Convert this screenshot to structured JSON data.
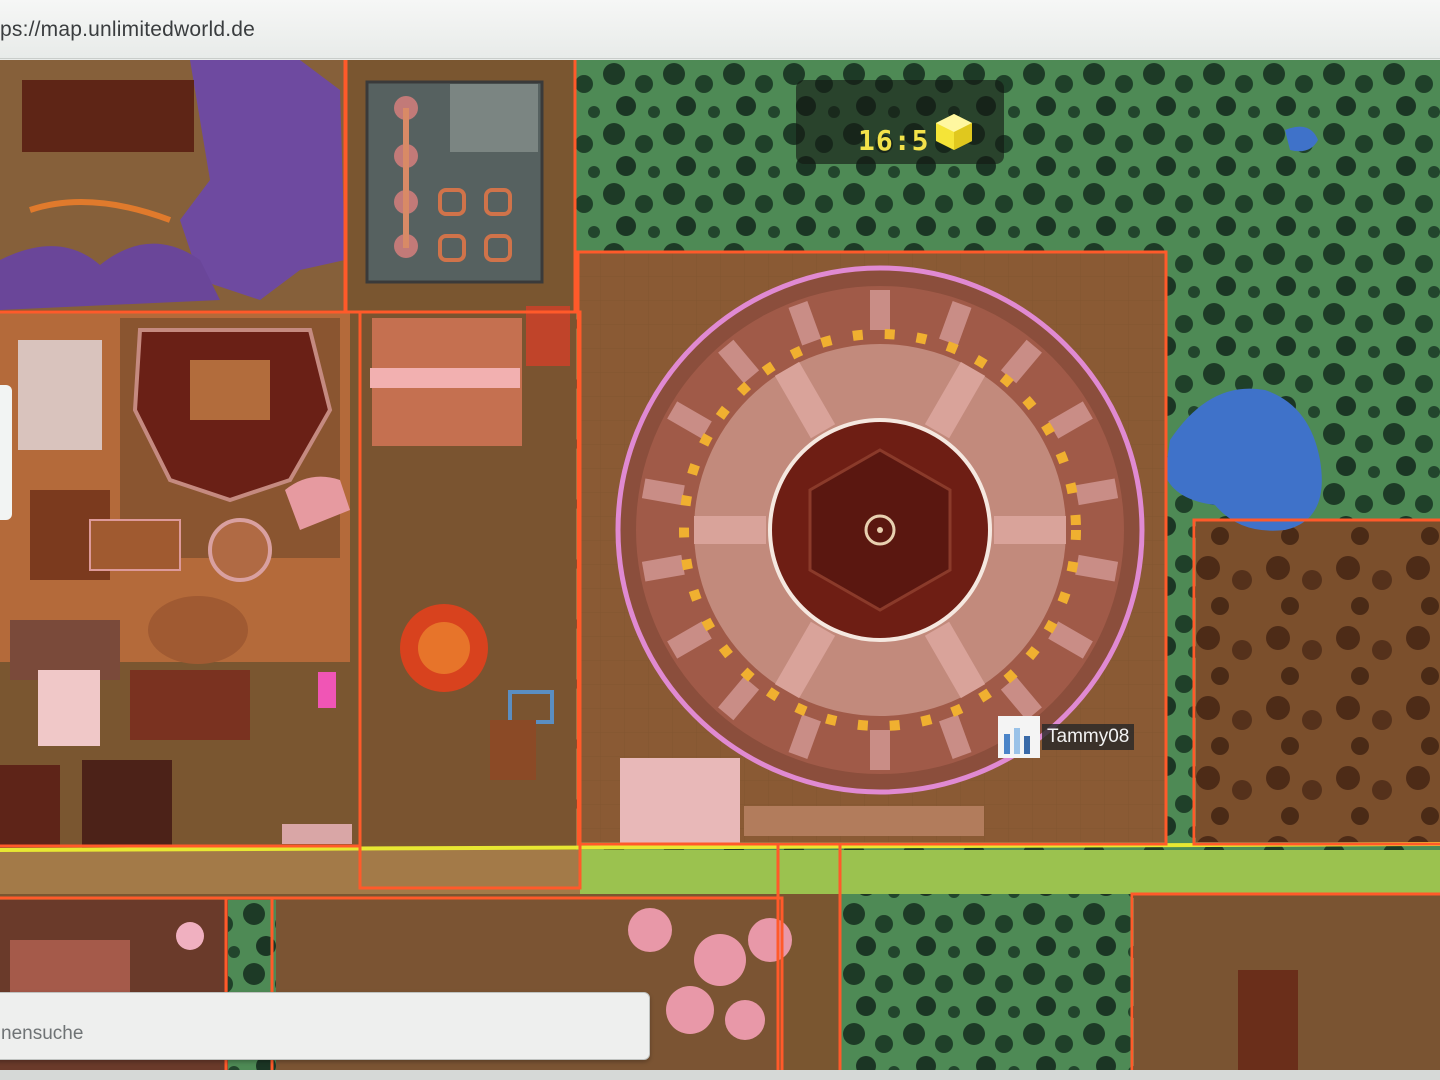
{
  "browser": {
    "url": "ps://map.unlimitedworld.de"
  },
  "map": {
    "clock_time": "16:5",
    "player": {
      "name": "Tammy08"
    },
    "search_placeholder": "nensuche"
  },
  "colors": {
    "claim_border": "#ff5a2a",
    "road_yellow": "#e8e832",
    "forest_dark": "#1d3a26",
    "grass": "#4f8a53",
    "dirt": "#7a5630",
    "water": "#3f72c9",
    "arena_pink": "#d38b8b"
  },
  "icons": [
    "sun-icon",
    "player-avatar-icon"
  ]
}
